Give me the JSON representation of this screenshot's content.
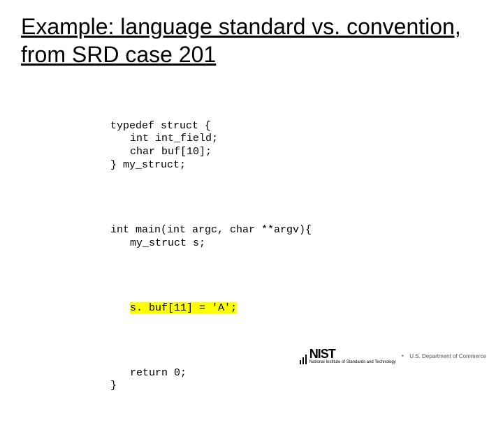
{
  "title": "Example: language standard vs. convention, from SRD case 201",
  "code": {
    "l1": "typedef struct {",
    "l2": "int int_field;",
    "l3": "char buf[10];",
    "l4": "} my_struct;",
    "l5": "int main(int argc, char **argv){",
    "l6": "my_struct s;",
    "l7": "s. buf[11] = 'A';",
    "l8": "return 0;",
    "l9": "}"
  },
  "footer": {
    "logo_main": "NIST",
    "logo_sub": "National Institute of Standards and Technology",
    "sep": "•",
    "dept": "U.S. Department of Commerce"
  }
}
